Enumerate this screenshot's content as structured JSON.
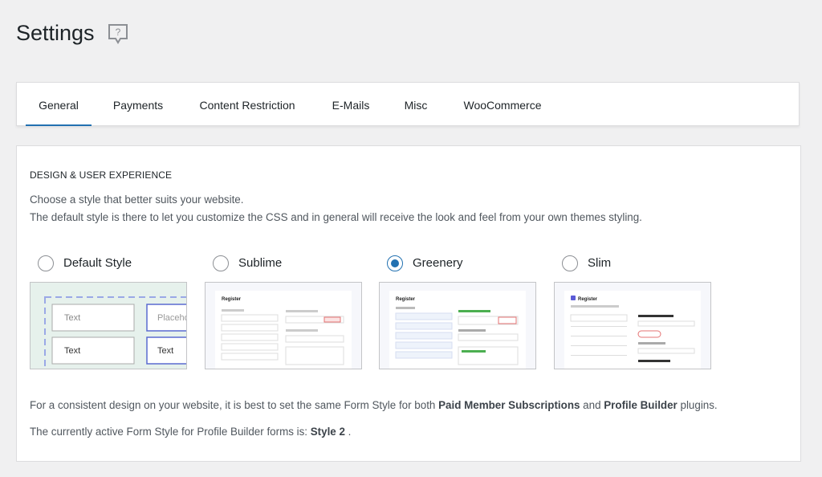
{
  "page": {
    "title": "Settings"
  },
  "tabs": [
    {
      "label": "General",
      "active": true
    },
    {
      "label": "Payments"
    },
    {
      "label": "Content Restriction"
    },
    {
      "label": "E-Mails"
    },
    {
      "label": "Misc"
    },
    {
      "label": "WooCommerce"
    }
  ],
  "section": {
    "heading": "DESIGN & USER EXPERIENCE",
    "desc_line1": "Choose a style that better suits your website.",
    "desc_line2": "The default style is there to let you customize the CSS and in general will receive the look and feel from your own themes styling."
  },
  "styles": [
    {
      "label": "Default Style",
      "checked": false,
      "preview": {
        "field1": "Text",
        "field2": "Placeho",
        "field3": "Text",
        "field4": "Text"
      }
    },
    {
      "label": "Sublime",
      "checked": false,
      "preview": {
        "title": "Register"
      }
    },
    {
      "label": "Greenery",
      "checked": true,
      "preview": {
        "title": "Register"
      }
    },
    {
      "label": "Slim",
      "checked": false,
      "preview": {
        "title": "Register"
      }
    }
  ],
  "notes": {
    "consistent_prefix": "For a consistent design on your website, it is best to set the same Form Style for both ",
    "plugin1": "Paid Member Subscriptions",
    "and": " and ",
    "plugin2": "Profile Builder",
    "consistent_suffix": " plugins.",
    "active_prefix": "The currently active Form Style for Profile Builder forms is: ",
    "active_style": "Style 2",
    "active_suffix": " ."
  },
  "colors": {
    "accent": "#2271b1",
    "greenery_accent": "#4caf50",
    "default_preview_bg": "#e6f1ec"
  }
}
